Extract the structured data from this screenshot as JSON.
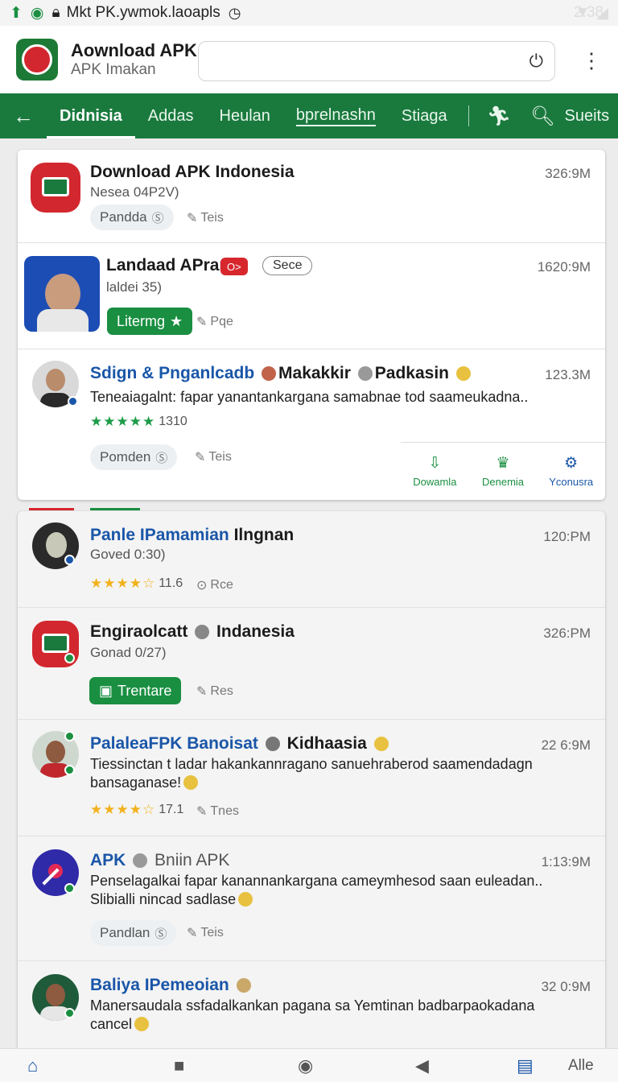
{
  "status_bar": {
    "title": "Mkt  PK.ywmok.laoapls",
    "time": "2:38"
  },
  "header": {
    "app_title": "Aownload APK",
    "app_subtitle": "APK Imakan",
    "search_placeholder": "",
    "search_value": ""
  },
  "tabs": {
    "items": [
      "Didnisia",
      "Addas",
      "Heulan",
      "bprelnashn",
      "Stiaga"
    ],
    "search_label": "Sueits"
  },
  "card1": {
    "items": [
      {
        "name": "Download APK Indonesia",
        "sub": "Nesea 04P2V)",
        "time": "326:9M",
        "chip": "Pandda",
        "edit": "Teis"
      },
      {
        "name": "Landaad APran",
        "badge": "O>",
        "badge_outline": "Sece",
        "sub": "laldei 35)",
        "time": "1620:9M",
        "button": "Litermg",
        "edit": "Pqe"
      },
      {
        "name_part1": "Sdign & Pnganlcadb",
        "name_part2": "Makakkir",
        "name_part3": "Padkasin",
        "desc": "Teneaiagalnt: fapar yanantankargana samabnae tod saameukadna..",
        "rating": "1310",
        "time": "123.3M",
        "chip": "Pomden",
        "edit": "Teis",
        "actions": [
          "Dowamla",
          "Denemia",
          "Yconusra"
        ]
      }
    ]
  },
  "card2": {
    "items": [
      {
        "name_part1": "Panle IPamamian",
        "name_part2": "Ilngnan",
        "sub": "Goved 0:30)",
        "rating": "11.6",
        "extra": "Rce",
        "time": "120:PM"
      },
      {
        "name_part1": "Engiraolcatt",
        "name_part2": "Indanesia",
        "sub": "Gonad 0/27)",
        "time": "326:PM",
        "button": "Trentare",
        "edit": "Res"
      },
      {
        "name_part1": "PalaleaFPK Banoisat",
        "name_part2": "Kidhaasia",
        "desc_line1": "Tiessinctan t ladar hakankannragano sanuehraberod saamendadagn",
        "desc_line2": "bansaganase!",
        "rating": "17.1",
        "edit": "Tnes",
        "time": "22 6:9M"
      },
      {
        "name_part1": "APK",
        "name_part2": "Bniin APK",
        "desc_line1": "Penselagalkai fapar kanannankargana cameymhesod saan euleadan..",
        "desc_line2": "Slibialli nincad sadlase",
        "time": "1:13:9M",
        "chip": "Pandlan",
        "edit": "Teis"
      },
      {
        "name_part1": "Baliya IPemeoian",
        "desc_line1": "Manersaudala ssfadalkankan pagana sa Yemtinan badbarpaokadana",
        "desc_line2": "cancel",
        "time": "32 0:9M"
      }
    ]
  },
  "bottom_nav": {
    "right_label": "Alle"
  },
  "colors": {
    "brand_green": "#1a7a3e",
    "accent_blue": "#1a56a8",
    "red": "#d7272d",
    "star_green": "#1d9b47",
    "star_gold": "#f2b21d"
  }
}
